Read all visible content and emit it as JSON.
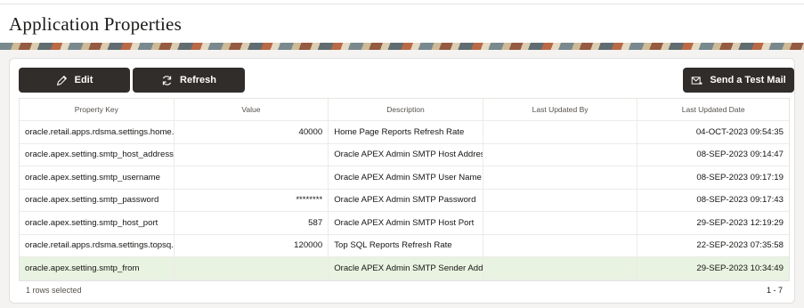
{
  "page": {
    "title": "Application Properties"
  },
  "toolbar": {
    "edit_label": "Edit",
    "refresh_label": "Refresh",
    "test_mail_label": "Send a Test Mail"
  },
  "grid": {
    "columns": [
      "Property Key",
      "Value",
      "Description",
      "Last Updated By",
      "Last Updated Date"
    ],
    "rows": [
      {
        "key": "oracle.retail.apps.rdsma.settings.home...",
        "value": "40000",
        "description": "Home Page Reports Refresh Rate",
        "updated_by": "",
        "updated_date": "04-OCT-2023 09:54:35",
        "selected": false
      },
      {
        "key": "oracle.apex.setting.smtp_host_address",
        "value": "",
        "description": "Oracle APEX Admin SMTP Host Address",
        "updated_by": "",
        "updated_date": "08-SEP-2023 09:14:47",
        "selected": false
      },
      {
        "key": "oracle.apex.setting.smtp_username",
        "value": "",
        "description": "Oracle APEX Admin SMTP User Name",
        "updated_by": "",
        "updated_date": "08-SEP-2023 09:17:19",
        "selected": false
      },
      {
        "key": "oracle.apex.setting.smtp_password",
        "value": "********",
        "description": "Oracle APEX Admin SMTP Password",
        "updated_by": "",
        "updated_date": "08-SEP-2023 09:17:43",
        "selected": false
      },
      {
        "key": "oracle.apex.setting.smtp_host_port",
        "value": "587",
        "description": "Oracle APEX Admin SMTP Host Port",
        "updated_by": "",
        "updated_date": "29-SEP-2023 12:19:29",
        "selected": false
      },
      {
        "key": "oracle.retail.apps.rdsma.settings.topsq...",
        "value": "120000",
        "description": "Top SQL Reports Refresh Rate",
        "updated_by": "",
        "updated_date": "22-SEP-2023 07:35:58",
        "selected": false
      },
      {
        "key": "oracle.apex.setting.smtp_from",
        "value": "",
        "description": "Oracle APEX Admin SMTP Sender Add...",
        "updated_by": "",
        "updated_date": "29-SEP-2023 10:34:49",
        "selected": true
      }
    ]
  },
  "footer": {
    "selection": "1 rows selected",
    "pagination": "1 - 7"
  },
  "colors": {
    "button_bg": "#312d2a",
    "selected_row": "#e8f3e1"
  }
}
